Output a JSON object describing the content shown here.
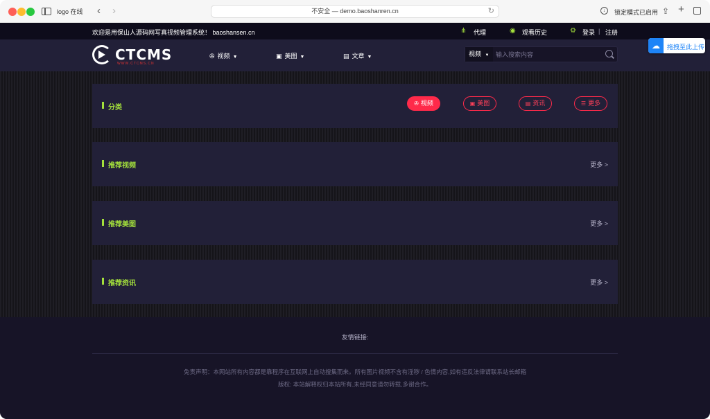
{
  "browser": {
    "tab_title": "logo 在线",
    "url": "不安全 — demo.baoshanren.cn",
    "lock_mode": "锁定模式已启用"
  },
  "topbar": {
    "welcome": "欢迎是用保山人源码网写真视频管理系统！ baoshansen.cn",
    "agent": "代理",
    "history": "观看历史",
    "login": "登录",
    "separator": "|",
    "register": "注册"
  },
  "header": {
    "logo_text": "CTCMS",
    "logo_sub": "WWW.CTCMS.CN",
    "nav": [
      {
        "label": "视频",
        "icon": "film-reel-icon"
      },
      {
        "label": "美图",
        "icon": "image-icon"
      },
      {
        "label": "文章",
        "icon": "document-icon"
      }
    ],
    "search": {
      "type": "视频",
      "placeholder": "输入搜索内容"
    }
  },
  "extension": {
    "label": "拖拽至此上传"
  },
  "sections": {
    "category": {
      "title": "分类",
      "buttons": [
        {
          "label": "视频",
          "active": true
        },
        {
          "label": "美图",
          "active": false
        },
        {
          "label": "资讯",
          "active": false
        },
        {
          "label": "更多",
          "active": false
        }
      ]
    },
    "rec_video": {
      "title": "推荐视频",
      "more": "更多 >"
    },
    "rec_image": {
      "title": "推荐美图",
      "more": "更多 >"
    },
    "rec_news": {
      "title": "推荐资讯",
      "more": "更多 >"
    }
  },
  "footer": {
    "friend_links": "友情链接:",
    "disclaimer": "免责声明：本网站所有内容都是靠程序在互联网上自动搜集而来。所有图片视频不含有淫秽 / 色情内容,如有违反法律请联系站长邮箱",
    "copyright": "版权: 本站解释权归本站所有,未经同意请勿转载,多谢合作。"
  },
  "colors": {
    "accent_green": "#a4e03c",
    "accent_red": "#ff2a4a",
    "panel_bg": "#222038",
    "page_bg": "#171427"
  }
}
